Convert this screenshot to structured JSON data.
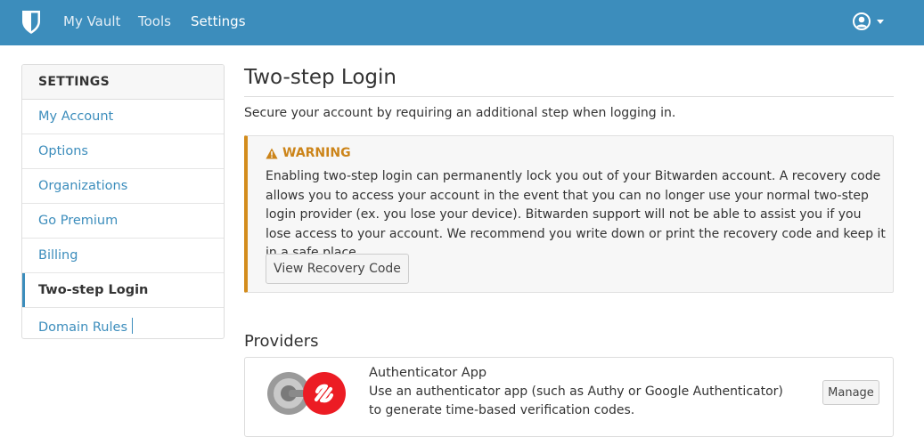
{
  "nav": {
    "links": [
      "My Vault",
      "Tools",
      "Settings"
    ],
    "active": "Settings"
  },
  "sidebar": {
    "header": "SETTINGS",
    "items": [
      {
        "label": "My Account"
      },
      {
        "label": "Options"
      },
      {
        "label": "Organizations"
      },
      {
        "label": "Go Premium"
      },
      {
        "label": "Billing"
      },
      {
        "label": "Two-step Login",
        "active": true
      },
      {
        "label": "Domain Rules"
      }
    ]
  },
  "main": {
    "title": "Two-step Login",
    "intro": "Secure your account by requiring an additional step when logging in.",
    "warning": {
      "title": "WARNING",
      "text": "Enabling two-step login can permanently lock you out of your Bitwarden account. A recovery code allows you to access your account in the event that you can no longer use your normal two-step login provider (ex. you lose your device). Bitwarden support will not be able to assist you if you lose access to your account. We recommend you write down or print the recovery code and keep it in a safe place.",
      "button_label": "View Recovery Code"
    },
    "providers_heading": "Providers",
    "providers": [
      {
        "name": "Authenticator App",
        "description": "Use an authenticator app (such as Authy or Google Authenticator) to generate time-based verification codes.",
        "button_label": "Manage",
        "icon": "authenticator-app-logo"
      }
    ]
  },
  "colors": {
    "topbar": "#3c8dbc",
    "link": "#3c8dbc",
    "warning_accent": "#d38c1c",
    "authy_red": "#ec1c24"
  }
}
